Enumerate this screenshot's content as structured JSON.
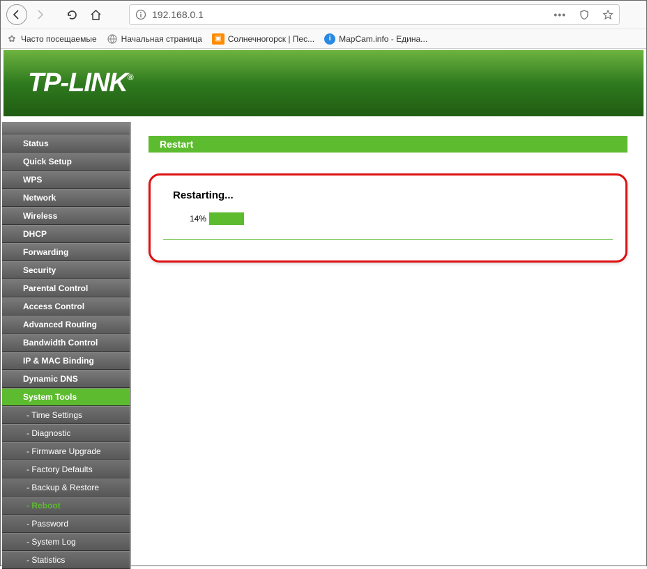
{
  "browser": {
    "url": "192.168.0.1",
    "bookmarks": [
      {
        "label": "Часто посещаемые",
        "icon": "gear"
      },
      {
        "label": "Начальная страница",
        "icon": "globe"
      },
      {
        "label": "Солнечногорск | Пес...",
        "icon": "car"
      },
      {
        "label": "MapCam.info - Едина...",
        "icon": "info"
      }
    ]
  },
  "logo": "TP-LINK",
  "sidebar": {
    "items": [
      {
        "label": "Status",
        "type": "main"
      },
      {
        "label": "Quick Setup",
        "type": "main"
      },
      {
        "label": "WPS",
        "type": "main"
      },
      {
        "label": "Network",
        "type": "main"
      },
      {
        "label": "Wireless",
        "type": "main"
      },
      {
        "label": "DHCP",
        "type": "main"
      },
      {
        "label": "Forwarding",
        "type": "main"
      },
      {
        "label": "Security",
        "type": "main"
      },
      {
        "label": "Parental Control",
        "type": "main"
      },
      {
        "label": "Access Control",
        "type": "main"
      },
      {
        "label": "Advanced Routing",
        "type": "main"
      },
      {
        "label": "Bandwidth Control",
        "type": "main"
      },
      {
        "label": "IP & MAC Binding",
        "type": "main"
      },
      {
        "label": "Dynamic DNS",
        "type": "main"
      },
      {
        "label": "System Tools",
        "type": "main",
        "active": true
      },
      {
        "label": "- Time Settings",
        "type": "sub"
      },
      {
        "label": "- Diagnostic",
        "type": "sub"
      },
      {
        "label": "- Firmware Upgrade",
        "type": "sub"
      },
      {
        "label": "- Factory Defaults",
        "type": "sub"
      },
      {
        "label": "- Backup & Restore",
        "type": "sub"
      },
      {
        "label": "- Reboot",
        "type": "sub",
        "selected": true
      },
      {
        "label": "- Password",
        "type": "sub"
      },
      {
        "label": "- System Log",
        "type": "sub"
      },
      {
        "label": "- Statistics",
        "type": "sub"
      }
    ]
  },
  "content": {
    "section_title": "Restart",
    "restart": {
      "title": "Restarting...",
      "percent_label": "14%",
      "percent_value": 14
    }
  }
}
